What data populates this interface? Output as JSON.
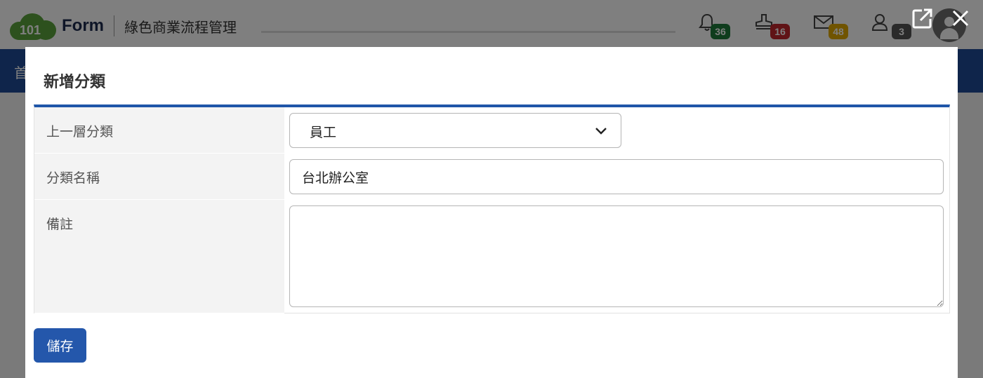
{
  "app": {
    "logo_number": "101",
    "logo_text": "Form",
    "subtitle": "綠色商業流程管理",
    "nav_first_char": "首"
  },
  "header_icons": [
    {
      "icon": "bell-icon",
      "badge": "36",
      "color": "#1e7a3a"
    },
    {
      "icon": "stamp-icon",
      "badge": "16",
      "color": "#c0262d"
    },
    {
      "icon": "mail-icon",
      "badge": "48",
      "color": "#e0a800"
    },
    {
      "icon": "user-icon",
      "badge": "3",
      "color": "#555555"
    }
  ],
  "modal": {
    "title": "新增分類",
    "fields": {
      "parent_label": "上一層分類",
      "parent_value": "員工",
      "name_label": "分類名稱",
      "name_value": "台北辦公室",
      "note_label": "備註",
      "note_value": ""
    },
    "save_label": "儲存"
  },
  "colors": {
    "primary": "#2457ab",
    "nav": "#1e4b96"
  }
}
